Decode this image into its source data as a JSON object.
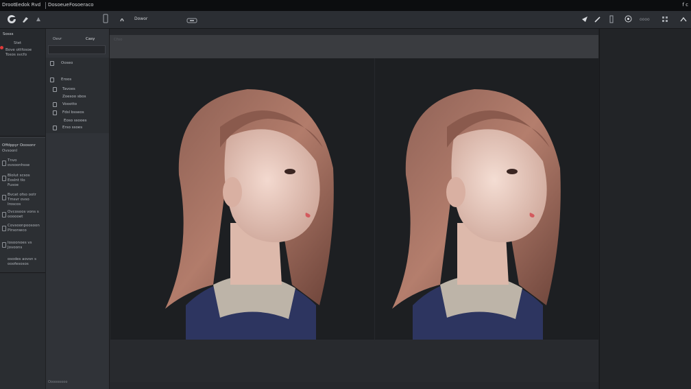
{
  "menubar": {
    "items": [
      "Droot",
      "Eedok Rvd",
      "Dosoeue",
      "Fosoeraco"
    ],
    "right": "f c"
  },
  "toolbar": {
    "tab_text": "Dowor",
    "right_text": "oooo"
  },
  "left_panel": {
    "tools_title": "Sosss",
    "tools_sub": "Stet",
    "tools_lines": [
      "Bove ottfosoe",
      "Tosos svcfo"
    ],
    "mid_title": "Offdppyr Ooosonr",
    "mid_sub": "Ovsoonl",
    "mid_lines": [
      "Tnvo",
      "ovsoonhsse",
      "Blolut scsos",
      "Eoslnt tlo",
      "Fusoe",
      "Bvcat ofso ootr",
      "Tmsvr ovso",
      "Iroscos",
      "Ovcosoos vons s",
      "oooooet",
      "Covsoonpoosoon",
      "Plrsonwco",
      "Iosoonoes vs",
      "Jovoons",
      "osodes aovsn s",
      "ooofesosos"
    ]
  },
  "layers_panel": {
    "title": "Oevr",
    "tab": "Casy",
    "rows": [
      "Ooseo",
      "Eroos",
      "Tavoes",
      "Zoesoo sbos",
      "Voootto",
      "Fdsl bsseos",
      "Eoso ssooes",
      "Erso ssoes"
    ],
    "footer": "Ooooooooo"
  },
  "canvas": {
    "strip_text": "Cfoo"
  }
}
